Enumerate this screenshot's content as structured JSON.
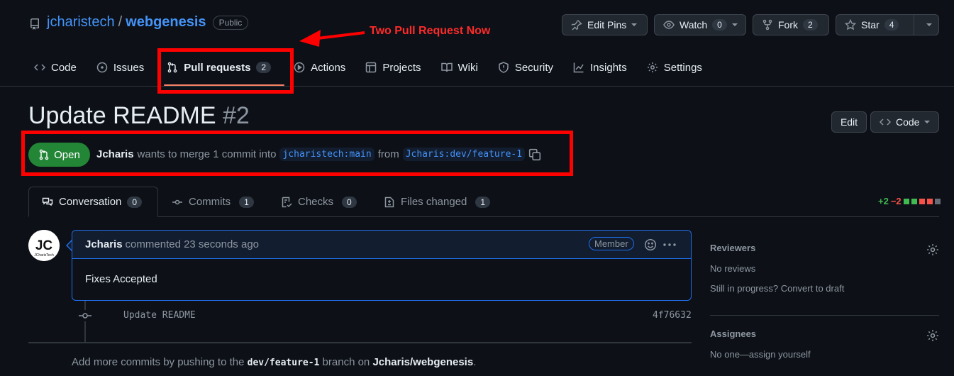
{
  "repo": {
    "owner": "jcharistech",
    "separator": "/",
    "name": "webgenesis",
    "visibility": "Public"
  },
  "actions": {
    "edit_pins": "Edit Pins",
    "watch": "Watch",
    "watch_count": "0",
    "fork": "Fork",
    "fork_count": "2",
    "star": "Star",
    "star_count": "4"
  },
  "annotation": {
    "text": "Two Pull Request Now",
    "color": "#ff0000"
  },
  "nav": {
    "tabs": [
      {
        "label": "Code",
        "icon": "code-icon"
      },
      {
        "label": "Issues",
        "icon": "issue-icon"
      },
      {
        "label": "Pull requests",
        "icon": "pull-request-icon",
        "count": "2",
        "active": true
      },
      {
        "label": "Actions",
        "icon": "play-icon"
      },
      {
        "label": "Projects",
        "icon": "table-icon"
      },
      {
        "label": "Wiki",
        "icon": "book-icon"
      },
      {
        "label": "Security",
        "icon": "shield-icon"
      },
      {
        "label": "Insights",
        "icon": "graph-icon"
      },
      {
        "label": "Settings",
        "icon": "gear-icon"
      }
    ]
  },
  "pr": {
    "title": "Update README",
    "number": "#2",
    "edit_label": "Edit",
    "code_label": "Code",
    "status": "Open",
    "author": "Jcharis",
    "merge_text": "wants to merge 1 commit into",
    "base_branch": "jcharistech:main",
    "from_text": "from",
    "head_branch": "Jcharis:dev/feature-1"
  },
  "pr_tabs": [
    {
      "label": "Conversation",
      "count": "0",
      "icon": "comment-discussion-icon",
      "active": true
    },
    {
      "label": "Commits",
      "count": "1",
      "icon": "git-commit-icon"
    },
    {
      "label": "Checks",
      "count": "0",
      "icon": "checklist-icon"
    },
    {
      "label": "Files changed",
      "count": "1",
      "icon": "file-diff-icon"
    }
  ],
  "diffstat": {
    "additions": "+2",
    "deletions": "−2",
    "colors": [
      "#3fb950",
      "#3fb950",
      "#f85149",
      "#f85149",
      "#656c76"
    ]
  },
  "comment": {
    "avatar_initials": "JC",
    "avatar_caption": "JCharisTech",
    "author": "Jcharis",
    "meta": "commented 23 seconds ago",
    "role": "Member",
    "body": "Fixes Accepted"
  },
  "commit": {
    "message": "Update README",
    "sha": "4f76632"
  },
  "footer": {
    "prefix": "Add more commits by pushing to the",
    "branch": "dev/feature-1",
    "middle": "branch on",
    "repo_owner": "Jcharis",
    "repo_sep": "/",
    "repo_name": "webgenesis",
    "end": "."
  },
  "sidebar": {
    "reviewers": {
      "heading": "Reviewers",
      "line1": "No reviews",
      "line2": "Still in progress? Convert to draft"
    },
    "assignees": {
      "heading": "Assignees",
      "line1": "No one—assign yourself"
    }
  }
}
